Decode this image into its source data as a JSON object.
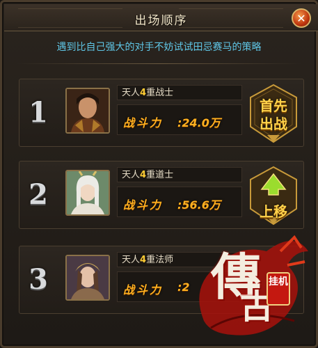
{
  "header": {
    "title": "出场顺序",
    "close_icon": "close-icon"
  },
  "subtitle": "遇到比自己强大的对手不妨试试田忌赛马的策略",
  "power_label": "战斗力",
  "rows": [
    {
      "rank": "1",
      "name_prefix": "天人",
      "tier": "4",
      "name_suffix": "重战士",
      "power": ":24.0万",
      "action": "首先出战",
      "action_line1": "首先",
      "action_line2": "出战"
    },
    {
      "rank": "2",
      "name_prefix": "天人",
      "tier": "4",
      "name_suffix": "重道士",
      "power": ":56.6万",
      "action": "上移",
      "action_line1": "上移",
      "action_line2": ""
    },
    {
      "rank": "3",
      "name_prefix": "天人",
      "tier": "4",
      "name_suffix": "重法师",
      "power": ":2",
      "action": "",
      "action_line1": "",
      "action_line2": ""
    }
  ],
  "watermark": {
    "main": "傳",
    "second": "古",
    "badge": "挂机"
  },
  "colors": {
    "accent_gold": "#ffb020",
    "subtitle_blue": "#5fc6e6",
    "close_red": "#c0360f"
  }
}
